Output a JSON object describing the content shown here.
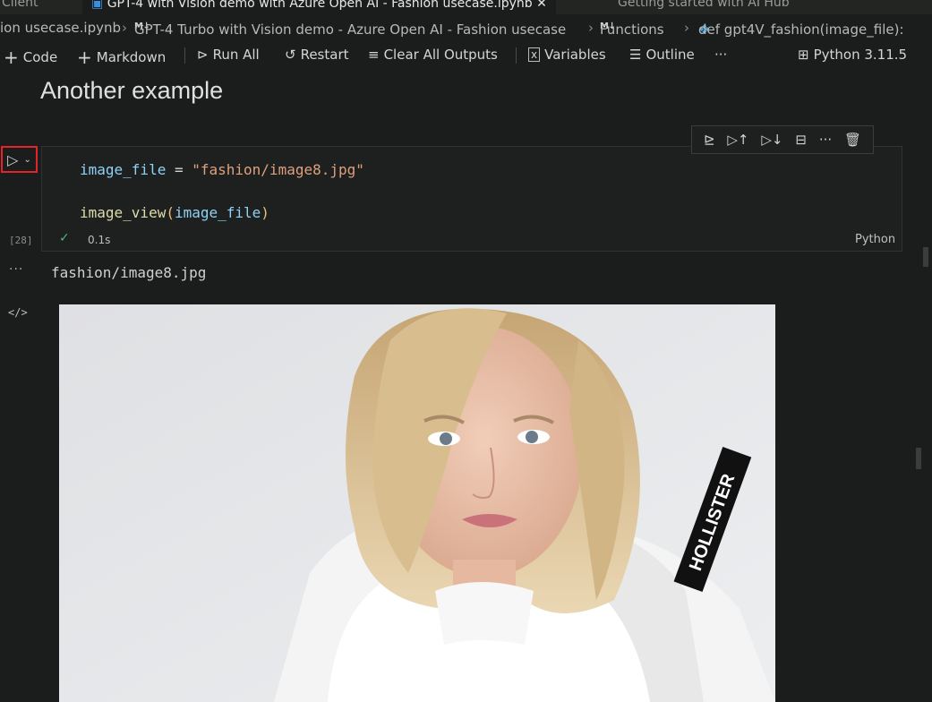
{
  "tabs": [
    {
      "label": "Client"
    },
    {
      "label": "GPT-4 with Vision demo with Azure Open AI - Fashion usecase.ipynb",
      "active": true
    },
    {
      "label": "Getting started with AI Hub"
    }
  ],
  "breadcrumb": {
    "file": "ion usecase.ipynb",
    "section1": "GPT-4 Turbo with Vision demo - Azure Open AI - Fashion usecase",
    "section2": "Functions",
    "symbol": "def gpt4V_fashion(image_file):"
  },
  "toolbar": {
    "code": "Code",
    "markdown": "Markdown",
    "run_all": "Run All",
    "restart": "Restart",
    "clear_outputs": "Clear All Outputs",
    "variables": "Variables",
    "outline": "Outline",
    "more": "···",
    "kernel": "Python 3.11.5"
  },
  "notebook": {
    "heading": "Another example",
    "cell": {
      "line1": {
        "var": "image_file",
        "op": " = ",
        "str": "\"fashion/image8.jpg\""
      },
      "line2": {
        "fn": "image_view",
        "open": "(",
        "arg": "image_file",
        "close": ")"
      },
      "exec_count": "[28]",
      "time": "0.1s",
      "language": "Python"
    },
    "output": {
      "text": "fashion/image8.jpg",
      "more": "···",
      "code_icon": "</>"
    },
    "image_brand_text": "HOLLISTER"
  },
  "colors": {
    "background": "#1b1d1c",
    "accent_red": "#e3242b",
    "success": "#4fb57a",
    "string": "#e0a07e",
    "variable": "#8fd1f7",
    "function": "#dcdcaa"
  }
}
